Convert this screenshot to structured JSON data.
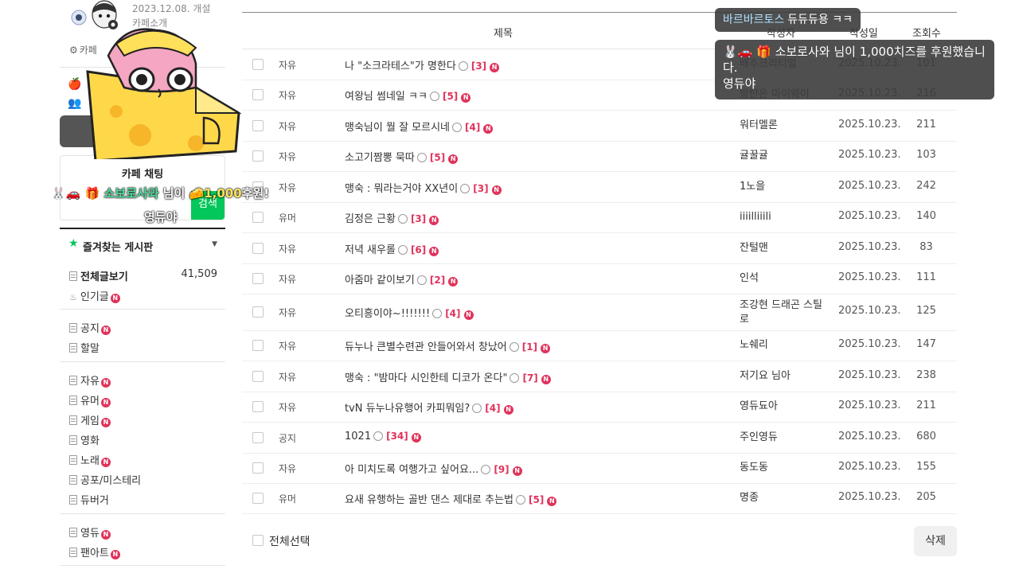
{
  "sidebar": {
    "cafe_date": "2023.12.08. 개설",
    "cafe_intro": "카페소개",
    "settings_label": "카페",
    "chat_title": "카페 채팅",
    "chat_search": "검색",
    "fav_title": "즐겨찾는 게시판",
    "menu": [
      {
        "label": "전체글보기",
        "count": "41,509"
      },
      {
        "label": "인기글"
      },
      {
        "label": "공지"
      },
      {
        "label": "할말"
      },
      {
        "label": "자유"
      },
      {
        "label": "유머"
      },
      {
        "label": "게임"
      },
      {
        "label": "영화"
      },
      {
        "label": "노래"
      },
      {
        "label": "공포/미스테리"
      },
      {
        "label": "듀버거"
      },
      {
        "label": "영듀"
      },
      {
        "label": "팬아트"
      }
    ]
  },
  "new_badge": "N",
  "table": {
    "headers": {
      "title": "제목",
      "author": "작성자",
      "date": "작성일",
      "views": "조회수"
    },
    "rows": [
      {
        "cat": "자유",
        "title": "나 \"소크라테스\"가 명한다",
        "cmt": "[3]",
        "author": "배추크리티얼",
        "date": "2025.10.23.",
        "views": "101"
      },
      {
        "cat": "자유",
        "title": "여왕님 썸네일 ㅋㅋ",
        "cmt": "[5]",
        "author": "방탄은 마이웨이",
        "date": "2025.10.23.",
        "views": "216"
      },
      {
        "cat": "자유",
        "title": "맹숙님이 뭘 잘 모르시네",
        "cmt": "[4]",
        "author": "워터멜론",
        "date": "2025.10.23.",
        "views": "211"
      },
      {
        "cat": "자유",
        "title": "소고기짬뽕 묵따",
        "cmt": "[5]",
        "author": "귤꿀귤",
        "date": "2025.10.23.",
        "views": "103"
      },
      {
        "cat": "자유",
        "title": "맹숙 : 뭐라는거야 XX년이",
        "cmt": "[3]",
        "author": "1노을",
        "date": "2025.10.23.",
        "views": "242"
      },
      {
        "cat": "유머",
        "title": "김정은 근황",
        "cmt": "[3]",
        "author": "iiiilliiili",
        "date": "2025.10.23.",
        "views": "140"
      },
      {
        "cat": "자유",
        "title": "저녁 새우롤",
        "cmt": "[6]",
        "author": "잔털맨",
        "date": "2025.10.23.",
        "views": "83"
      },
      {
        "cat": "자유",
        "title": "아줌마 같이보기",
        "cmt": "[2]",
        "author": "인석",
        "date": "2025.10.23.",
        "views": "111"
      },
      {
        "cat": "자유",
        "title": "오티흥이야~!!!!!!!",
        "cmt": "[4]",
        "author": "조강현 드래곤 스틸로",
        "date": "2025.10.23.",
        "views": "125"
      },
      {
        "cat": "자유",
        "title": "듀누나 큰별수련관 안들어와서 창났어",
        "cmt": "[1]",
        "author": "노쉐리",
        "date": "2025.10.23.",
        "views": "147"
      },
      {
        "cat": "자유",
        "title": "맹숙 : \"밤마다 시인한테 디코가 온다\"",
        "cmt": "[7]",
        "author": "저기요 님아",
        "date": "2025.10.23.",
        "views": "238"
      },
      {
        "cat": "자유",
        "title": "tvN 듀누나유행어 카피뭐임?",
        "cmt": "[4]",
        "author": "영듀됴아",
        "date": "2025.10.23.",
        "views": "211"
      },
      {
        "cat": "공지",
        "title": "1021",
        "cmt": "[34]",
        "author": "주인영듀",
        "date": "2025.10.23.",
        "views": "680"
      },
      {
        "cat": "자유",
        "title": "아 미치도록 여행가고 싶어요...",
        "cmt": "[9]",
        "author": "동도동",
        "date": "2025.10.23.",
        "views": "155"
      },
      {
        "cat": "유머",
        "title": "요새 유행하는 골반 댄스 제대로 추는법",
        "cmt": "[5]",
        "author": "명종",
        "date": "2025.10.23.",
        "views": "205"
      }
    ],
    "select_all": "전체선택",
    "delete": "삭제"
  },
  "overlay": {
    "chat_nick": "바르바르토스",
    "chat_text": "듀듀듀용 ㅋㅋ",
    "donation_line1": "🐰🚗 🎁 소보로사와 님이 1,000치즈를 후원했습니다.",
    "donation_line2": "영듀야",
    "alert_name": "소보로사와",
    "alert_suffix": " 님이 ",
    "alert_amount": "1,000",
    "alert_tail": "후원!",
    "alert_msg": "영듀야"
  },
  "colors": {
    "accent_green": "#03c75a",
    "new_badge": "#e0335b"
  }
}
